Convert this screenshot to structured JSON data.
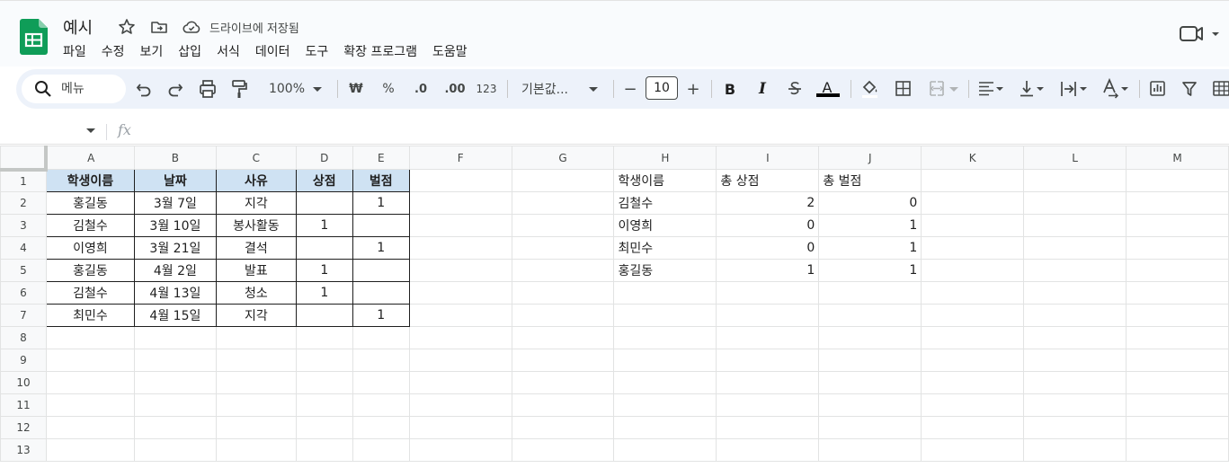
{
  "app": {
    "doc_title": "예시",
    "saved_status": "드라이브에 저장됨",
    "brand_color": "#0f9d58"
  },
  "menu": [
    "파일",
    "수정",
    "보기",
    "삽입",
    "서식",
    "데이터",
    "도구",
    "확장 프로그램",
    "도움말"
  ],
  "toolbar": {
    "search_label": "메뉴",
    "zoom": "100%",
    "currency": "₩",
    "percent": "%",
    "dec_decrease": ".0",
    "dec_increase": ".00",
    "number_format": "123",
    "font_family": "기본값...",
    "font_size": "10",
    "minus": "−",
    "plus": "+",
    "bold": "B",
    "italic": "I",
    "text_color": "A"
  },
  "formula_bar": {
    "fx": "fx"
  },
  "grid": {
    "columns": [
      "A",
      "B",
      "C",
      "D",
      "E",
      "F",
      "G",
      "H",
      "I",
      "J",
      "K",
      "L",
      "M"
    ],
    "rows": [
      "1",
      "2",
      "3",
      "4",
      "5",
      "6",
      "7",
      "8",
      "9",
      "10",
      "11",
      "12",
      "13"
    ],
    "table1": {
      "headers": [
        "학생이름",
        "날짜",
        "사유",
        "상점",
        "벌점"
      ],
      "rows": [
        [
          "홍길동",
          "3월 7일",
          "지각",
          "",
          "1"
        ],
        [
          "김철수",
          "3월 10일",
          "봉사활동",
          "1",
          ""
        ],
        [
          "이영희",
          "3월 21일",
          "결석",
          "",
          "1"
        ],
        [
          "홍길동",
          "4월 2일",
          "발표",
          "1",
          ""
        ],
        [
          "김철수",
          "4월 13일",
          "청소",
          "1",
          ""
        ],
        [
          "최민수",
          "4월 15일",
          "지각",
          "",
          "1"
        ]
      ]
    },
    "table2": {
      "headers": [
        "학생이름",
        "총 상점",
        "총 벌점"
      ],
      "rows": [
        [
          "김철수",
          "2",
          "0"
        ],
        [
          "이영희",
          "0",
          "1"
        ],
        [
          "최민수",
          "0",
          "1"
        ],
        [
          "홍길동",
          "1",
          "1"
        ]
      ]
    }
  }
}
